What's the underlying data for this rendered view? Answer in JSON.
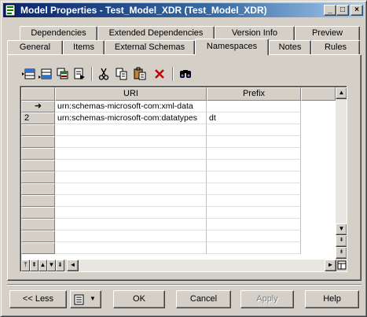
{
  "window": {
    "title": "Model Properties - Test_Model_XDR (Test_Model_XDR)",
    "controls": {
      "minimize": "_",
      "maximize": "□",
      "close": "×"
    }
  },
  "tabs_back": [
    "Dependencies",
    "Extended Dependencies",
    "Version Info",
    "Preview"
  ],
  "tabs_front": [
    "General",
    "Items",
    "External Schemas",
    "Namespaces",
    "Notes",
    "Rules"
  ],
  "active_tab": "Namespaces",
  "toolbar": {
    "icons": [
      "insert-row-icon",
      "add-row-icon",
      "add-objects-icon",
      "create-object-icon",
      "cut-icon",
      "copy-icon",
      "paste-icon",
      "delete-icon",
      "find-icon"
    ]
  },
  "grid": {
    "columns": [
      "URI",
      "Prefix"
    ],
    "rows": [
      {
        "marker": "➜",
        "uri": "urn:schemas-microsoft-com:xml-data",
        "prefix": ""
      },
      {
        "marker": "2",
        "uri": "urn:schemas-microsoft-com:datatypes",
        "prefix": "dt"
      }
    ],
    "empty_rows": 11,
    "scroll": {
      "up": "▲",
      "down": "▼",
      "left": "◄",
      "right": "►"
    },
    "nav": {
      "first": "⤒",
      "prev_page": "⇞",
      "prev": "▲",
      "next": "▼",
      "next_page": "⇟",
      "last": "⤓"
    }
  },
  "buttons": {
    "less": "<< Less",
    "menu_arrow": "▼",
    "ok": "OK",
    "cancel": "Cancel",
    "apply": "Apply",
    "help": "Help"
  },
  "colors": {
    "title_start": "#0a246a",
    "title_end": "#a6caf0",
    "face": "#d4d0c8",
    "delete_icon": "#c00000"
  }
}
